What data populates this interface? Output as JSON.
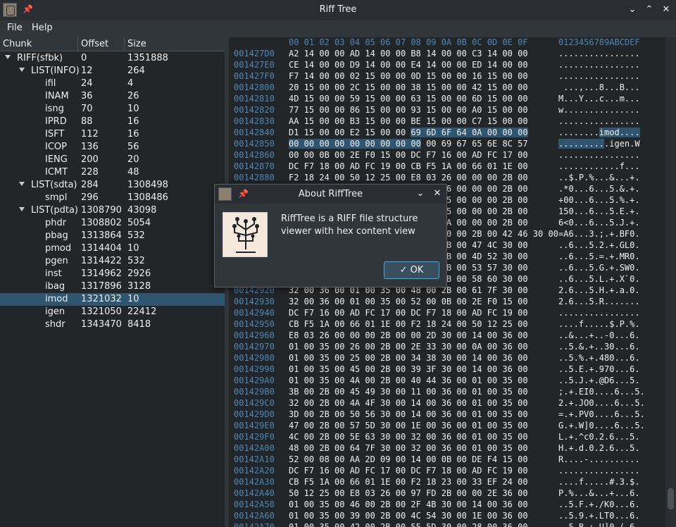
{
  "window": {
    "title": "Riff Tree",
    "icons": [
      "app-icon",
      "pin-icon",
      "minimize-icon",
      "maximize-icon",
      "close-icon"
    ]
  },
  "menu": {
    "file": "File",
    "help": "Help"
  },
  "tree": {
    "columns": [
      "Chunk",
      "Offset",
      "Size"
    ],
    "rows": [
      {
        "name": "RIFF(sfbk)",
        "offset": "0",
        "size": "1351888",
        "level": 0,
        "expandable": true
      },
      {
        "name": "LIST(INFO)",
        "offset": "12",
        "size": "264",
        "level": 1,
        "expandable": true
      },
      {
        "name": "ifil",
        "offset": "24",
        "size": "4",
        "level": 2,
        "expandable": false
      },
      {
        "name": "INAM",
        "offset": "36",
        "size": "26",
        "level": 2,
        "expandable": false
      },
      {
        "name": "isng",
        "offset": "70",
        "size": "10",
        "level": 2,
        "expandable": false
      },
      {
        "name": "IPRD",
        "offset": "88",
        "size": "16",
        "level": 2,
        "expandable": false
      },
      {
        "name": "ISFT",
        "offset": "112",
        "size": "16",
        "level": 2,
        "expandable": false
      },
      {
        "name": "ICOP",
        "offset": "136",
        "size": "56",
        "level": 2,
        "expandable": false
      },
      {
        "name": "IENG",
        "offset": "200",
        "size": "20",
        "level": 2,
        "expandable": false
      },
      {
        "name": "ICMT",
        "offset": "228",
        "size": "48",
        "level": 2,
        "expandable": false
      },
      {
        "name": "LIST(sdta)",
        "offset": "284",
        "size": "1308498",
        "level": 1,
        "expandable": true
      },
      {
        "name": "smpl",
        "offset": "296",
        "size": "1308486",
        "level": 2,
        "expandable": false
      },
      {
        "name": "LIST(pdta)",
        "offset": "1308790",
        "size": "43098",
        "level": 1,
        "expandable": true
      },
      {
        "name": "phdr",
        "offset": "1308802",
        "size": "5054",
        "level": 2,
        "expandable": false
      },
      {
        "name": "pbag",
        "offset": "1313864",
        "size": "532",
        "level": 2,
        "expandable": false
      },
      {
        "name": "pmod",
        "offset": "1314404",
        "size": "10",
        "level": 2,
        "expandable": false
      },
      {
        "name": "pgen",
        "offset": "1314422",
        "size": "532",
        "level": 2,
        "expandable": false
      },
      {
        "name": "inst",
        "offset": "1314962",
        "size": "2926",
        "level": 2,
        "expandable": false
      },
      {
        "name": "ibag",
        "offset": "1317896",
        "size": "3128",
        "level": 2,
        "expandable": false
      },
      {
        "name": "imod",
        "offset": "1321032",
        "size": "10",
        "level": 2,
        "expandable": false,
        "selected": true
      },
      {
        "name": "igen",
        "offset": "1321050",
        "size": "22412",
        "level": 2,
        "expandable": false
      },
      {
        "name": "shdr",
        "offset": "1343470",
        "size": "8418",
        "level": 2,
        "expandable": false
      }
    ]
  },
  "hex": {
    "header_bytes": "00 01 02 03 04 05 06 07 08 09 0A 0B 0C 0D 0E 0F",
    "header_ascii": "0123456789ABCDEF",
    "rows": [
      {
        "addr": "001427D0",
        "bytes": "A2 14 00 00 AD 14 00 00 B8 14 00 00 C3 14 00 00",
        "ascii": "................"
      },
      {
        "addr": "001427E0",
        "bytes": "CE 14 00 00 D9 14 00 00 E4 14 00 00 ED 14 00 00",
        "ascii": "................"
      },
      {
        "addr": "001427F0",
        "bytes": "F7 14 00 00 02 15 00 00 0D 15 00 00 16 15 00 00",
        "ascii": "................"
      },
      {
        "addr": "00142800",
        "bytes": "20 15 00 00 2C 15 00 00 38 15 00 00 42 15 00 00",
        "ascii": " ...,...8...B..."
      },
      {
        "addr": "00142810",
        "bytes": "4D 15 00 00 59 15 00 00 63 15 00 00 6D 15 00 00",
        "ascii": "M...Y...c...m..."
      },
      {
        "addr": "00142820",
        "bytes": "77 15 00 00 86 15 00 00 93 15 00 00 A0 15 00 00",
        "ascii": "w..............."
      },
      {
        "addr": "00142830",
        "bytes": "AA 15 00 00 B3 15 00 00 BE 15 00 00 C7 15 00 00",
        "ascii": "................"
      },
      {
        "addr": "00142840",
        "bytes": "D1 15 00 00 E2 15 00 00 69 6D 6F 64 0A 00 00 00",
        "ascii": "........imod....",
        "hl": "first"
      },
      {
        "addr": "00142850",
        "bytes": "00 00 00 00 00 00 00 00 00 00 69 67 65 6E 8C 57",
        "ascii": "..........igen.W",
        "hl": "second"
      },
      {
        "addr": "00142860",
        "bytes": "00 00 0B 00 2E F0 15 00 DC F7 16 00 AD FC 17 00",
        "ascii": "................"
      },
      {
        "addr": "00142870",
        "bytes": "DC F7 18 00 AD FC 19 00 CB F5 1A 00 66 01 1E 00",
        "ascii": "............f..."
      },
      {
        "addr": "00142880",
        "bytes": "F2 18 24 00 50 12 25 00 E8 03 26 00 00 00 2B 00",
        "ascii": "..$.P.%...&...+."
      },
      {
        "addr": "00142890",
        "bytes": "2E 2A 30 00 36 00 01 00 35 00 26 00 00 00 2B 00",
        "ascii": ".*0...6...5.&.+."
      },
      {
        "addr": "001428A0",
        "bytes": "2B 30 30 00 36 00 01 00 35 00 25 00 00 00 2B 00",
        "ascii": "+00...6...5.%.+."
      },
      {
        "addr": "001428B0",
        "bytes": "31 35 30 00 36 00 01 00 35 00 45 00 00 00 2B 00",
        "ascii": "150...6...5.E.+."
      },
      {
        "addr": "001428C0",
        "bytes": "36 3C 30 00 36 00 01 00 35 00 4A 00 00 00 2B 00",
        "ascii": "6<0...6...5.J.+."
      },
      {
        "addr": "001428D0",
        "bytes": "3D 41 36 00 33 00 01 00 3B 00 00 00 2B 00 42 46 30 00",
        "ascii": "=A6...3.;.+.BF0."
      },
      {
        "addr": "001428E0",
        "bytes": "00 2E 36 00 01 00 35 00 32 00 2B 00 47 4C 30 00",
        "ascii": "..6...5.2.+.GL0."
      },
      {
        "addr": "001428F0",
        "bytes": "00 2E 36 00 01 00 35 00 3D 00 2B 00 4D 52 30 00",
        "ascii": "..6...5.=.+.MR0."
      },
      {
        "addr": "00142900",
        "bytes": "00 2E 36 00 01 00 35 00 47 00 2B 00 53 57 30 00",
        "ascii": "..6...5.G.+.SW0."
      },
      {
        "addr": "00142910",
        "bytes": "00 2E 36 00 01 00 35 00 4C 00 2B 00 58 60 30 00",
        "ascii": "..6...5.L.+.X`0."
      },
      {
        "addr": "00142920",
        "bytes": "32 00 36 00 01 00 35 00 48 00 2B 00 61 7F 30 00",
        "ascii": "2.6...5.H.+.a.0."
      },
      {
        "addr": "00142930",
        "bytes": "32 00 36 00 01 00 35 00 52 00 0B 00 2E F0 15 00",
        "ascii": "2.6...5.R......."
      },
      {
        "addr": "00142940",
        "bytes": "DC F7 16 00 AD FC 17 00 DC F7 18 00 AD FC 19 00",
        "ascii": "................"
      },
      {
        "addr": "00142950",
        "bytes": "CB F5 1A 00 66 01 1E 00 F2 18 24 00 50 12 25 00",
        "ascii": "....f.....$.P.%."
      },
      {
        "addr": "00142960",
        "bytes": "E8 03 26 00 00 00 2B 00 00 2D 30 00 14 00 36 00",
        "ascii": "..&...+..-0...6."
      },
      {
        "addr": "00142970",
        "bytes": "01 00 35 00 26 00 2B 00 2E 33 30 00 0A 00 36 00",
        "ascii": "..5.&.+..30...6."
      },
      {
        "addr": "00142980",
        "bytes": "01 00 35 00 25 00 2B 00 34 38 30 00 14 00 36 00",
        "ascii": "..5.%.+.480...6."
      },
      {
        "addr": "00142990",
        "bytes": "01 00 35 00 45 00 2B 00 39 3F 30 00 14 00 36 00",
        "ascii": "..5.E.+.970...6."
      },
      {
        "addr": "001429A0",
        "bytes": "01 00 35 00 4A 00 2B 00 40 44 36 00 01 00 35 00",
        "ascii": "..5.J.+.@D6...5."
      },
      {
        "addr": "001429B0",
        "bytes": "3B 00 2B 00 45 49 30 00 11 00 36 00 01 00 35 00",
        "ascii": ";.+.EI0....6...5."
      },
      {
        "addr": "001429C0",
        "bytes": "32 00 2B 00 4A 4F 30 00 14 00 36 00 01 00 35 00",
        "ascii": "2.+.JO0....6...5."
      },
      {
        "addr": "001429D0",
        "bytes": "3D 00 2B 00 50 56 30 00 14 00 36 00 01 00 35 00",
        "ascii": "=.+.PV0....6...5."
      },
      {
        "addr": "001429E0",
        "bytes": "47 00 2B 00 57 5D 30 00 1E 00 36 00 01 00 35 00",
        "ascii": "G.+.W]0....6...5."
      },
      {
        "addr": "001429F0",
        "bytes": "4C 00 2B 00 5E 63 30 00 32 00 36 00 01 00 35 00",
        "ascii": "L.+.^c0.2.6...5."
      },
      {
        "addr": "00142A00",
        "bytes": "48 00 2B 00 64 7F 30 00 32 00 36 00 01 00 35 00",
        "ascii": "H.+.d.0.2.6...5."
      },
      {
        "addr": "00142A10",
        "bytes": "52 00 08 00 AA 2D 09 00 14 00 0B 00 DE F4 15 00",
        "ascii": "R....-.........."
      },
      {
        "addr": "00142A20",
        "bytes": "DC F7 16 00 AD FC 17 00 DC F7 18 00 AD FC 19 00",
        "ascii": "................"
      },
      {
        "addr": "00142A30",
        "bytes": "CB F5 1A 00 66 01 1E 00 F2 18 23 00 33 EF 24 00",
        "ascii": "....f.....#.3.$."
      },
      {
        "addr": "00142A40",
        "bytes": "50 12 25 00 E8 03 26 00 97 FD 2B 00 00 2E 36 00",
        "ascii": "P.%...&...+...6."
      },
      {
        "addr": "00142A50",
        "bytes": "01 00 35 00 46 00 2B 00 2F 4B 30 00 14 00 36 00",
        "ascii": "..5.F.+./K0...6."
      },
      {
        "addr": "00142A60",
        "bytes": "01 00 35 00 39 00 2B 00 4C 54 30 00 1E 00 36 00",
        "ascii": "..5.9.+.LT0...6."
      },
      {
        "addr": "00142A70",
        "bytes": "01 00 35 00 42 00 2B 00 55 5D 30 00 28 00 36 00",
        "ascii": "..5.B.+.U]0.(.6."
      }
    ]
  },
  "dialog": {
    "title": "About RiffTree",
    "message": "RiffTree is a RIFF file structure viewer with hex content view",
    "ok_label": "OK",
    "icons": [
      "app-logo",
      "pin-icon",
      "minimize-icon",
      "close-icon",
      "checkmark-icon"
    ]
  },
  "colors": {
    "background": "#232629",
    "chrome": "#31363b",
    "address": "#4a87b8",
    "selection": "#2e5670",
    "accent": "#3daee9"
  }
}
